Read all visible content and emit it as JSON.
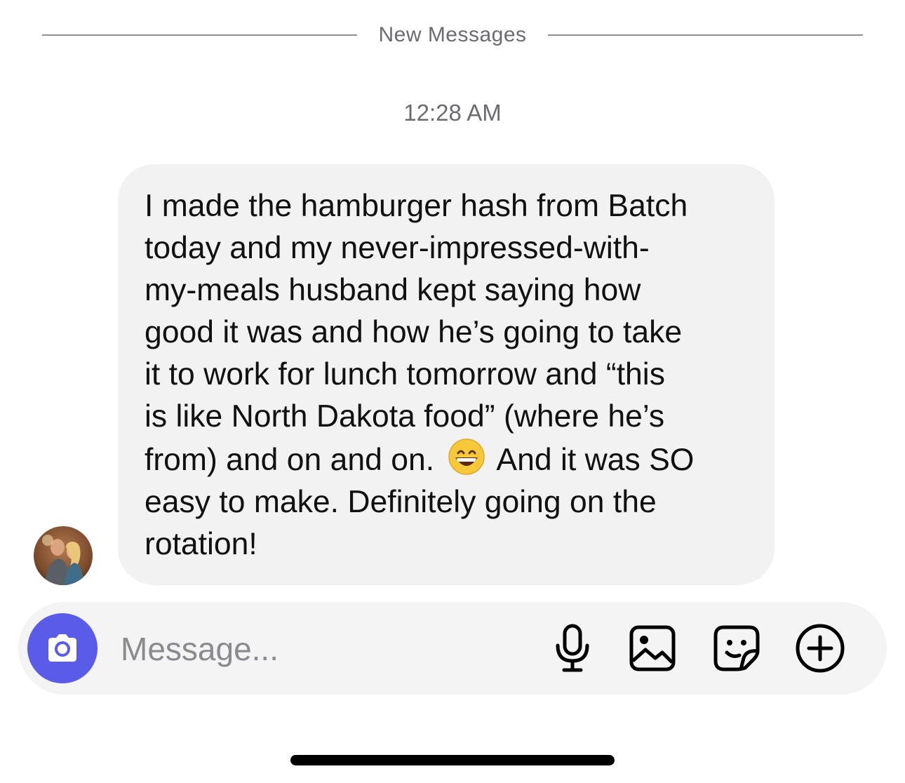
{
  "divider": {
    "label": "New Messages"
  },
  "timestamp": "12:28 AM",
  "message": {
    "text_part1": "I made the hamburger hash from Batch\ntoday and my never-impressed-with-\nmy-meals husband kept saying how\ngood it was and how he’s going to take\nit to work for lunch tomorrow and “this\nis like North Dakota food” (where he’s\nfrom) and on and on.",
    "emoji": "grinning-face-with-smiling-eyes",
    "text_part2": "And it was SO\neasy to make. Definitely going on the\nrotation!",
    "bubble_color": "#f2f2f3"
  },
  "composer": {
    "placeholder": "Message...",
    "camera_color": "#5b5bea",
    "icons": [
      "camera-icon",
      "microphone-icon",
      "gallery-icon",
      "sticker-icon",
      "plus-icon"
    ]
  }
}
